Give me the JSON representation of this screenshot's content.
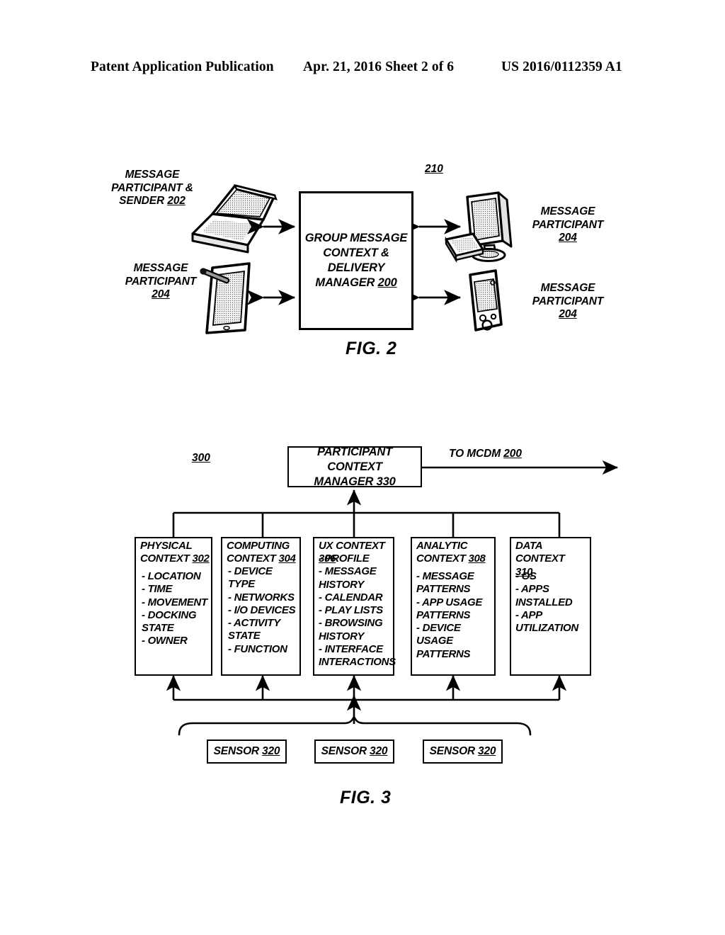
{
  "header": {
    "left": "Patent Application Publication",
    "middle": "Apr. 21, 2016  Sheet 2 of 6",
    "right": "US 2016/0112359 A1"
  },
  "fig2": {
    "caption": "FIG. 2",
    "system_ref": "210",
    "center_box": "GROUP MESSAGE\nCONTEXT &\nDELIVERY\nMANAGER 200",
    "center_box_lines": [
      "GROUP MESSAGE",
      "CONTEXT &",
      "DELIVERY",
      "MANAGER "
    ],
    "center_box_ref": "200",
    "labels": {
      "top_left": "MESSAGE\nPARTICIPANT &\nSENDER ",
      "top_left_ref": "202",
      "bottom_left": "MESSAGE\nPARTICIPANT\n",
      "bottom_left_ref": "204",
      "top_right": "MESSAGE\nPARTICIPANT\n",
      "top_right_ref": "204",
      "bottom_right": "MESSAGE\nPARTICIPANT\n",
      "bottom_right_ref": "204"
    },
    "devices": {
      "top_left": "laptop-icon",
      "bottom_left": "tablet-stylus-icon",
      "top_right": "desktop-monitor-keyboard-icon",
      "bottom_right": "pda-phone-icon"
    }
  },
  "fig3": {
    "caption": "FIG. 3",
    "system_ref": "300",
    "manager_box": "PARTICIPANT CONTEXT\nMANAGER ",
    "manager_box_ref": "330",
    "output_label": "TO MCDM ",
    "output_ref": "200",
    "context_boxes": [
      {
        "title": "PHYSICAL\nCONTEXT  ",
        "ref": "302",
        "items": "- LOCATION\n- TIME\n- MOVEMENT\n- DOCKING\n  STATE\n- OWNER"
      },
      {
        "title": "COMPUTING\nCONTEXT ",
        "ref": "304",
        "items": "- DEVICE TYPE\n- NETWORKS\n- I/O DEVICES\n- ACTIVITY\n  STATE\n- FUNCTION"
      },
      {
        "title": "UX CONTEXT ",
        "ref": "306",
        "items": "- PROFILE\n- MESSAGE\n  HISTORY\n- CALENDAR\n- PLAY LISTS\n- BROWSING\n  HISTORY\n- INTERFACE\n   INTERACTIONS"
      },
      {
        "title": "ANALYTIC\nCONTEXT ",
        "ref": "308",
        "items": "- MESSAGE\n  PATTERNS\n- APP USAGE\n  PATTERNS\n- DEVICE USAGE\n  PATTERNS"
      },
      {
        "title": "DATA CONTEXT\n",
        "ref": "310",
        "items": "- OS\n- APPS\n  INSTALLED\n- APP\n  UTILIZATION"
      }
    ],
    "sensors": [
      {
        "label": "SENSOR ",
        "ref": "320"
      },
      {
        "label": "SENSOR ",
        "ref": "320"
      },
      {
        "label": "SENSOR ",
        "ref": "320"
      }
    ]
  },
  "colors": {
    "ink": "#000000",
    "paper": "#ffffff"
  }
}
